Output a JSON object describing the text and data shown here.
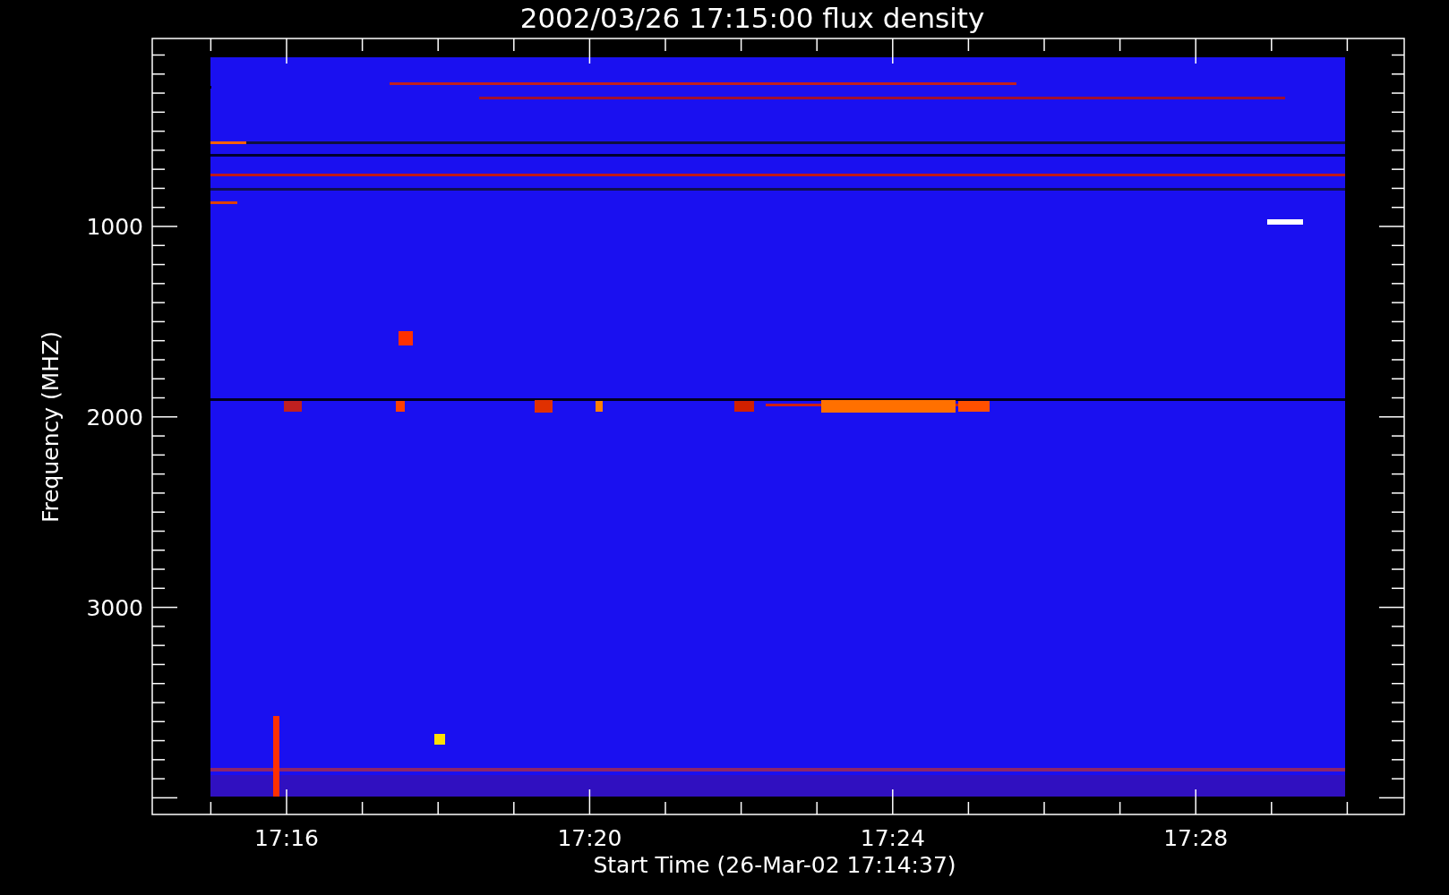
{
  "title": "2002/03/26 17:15:00 flux density",
  "y_axis": {
    "label": "Frequency (MHZ)",
    "ticks": [
      "1000",
      "2000",
      "3000"
    ]
  },
  "x_axis": {
    "label": "Start Time (26-Mar-02 17:14:37)",
    "ticks": [
      "17:16",
      "17:20",
      "17:24",
      "17:28"
    ]
  }
}
